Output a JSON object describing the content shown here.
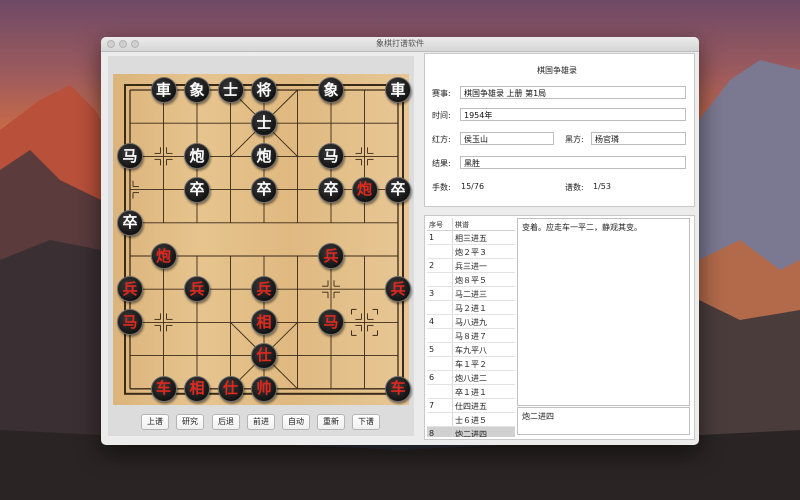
{
  "window": {
    "title": "象棋打谱软件"
  },
  "toolbar": {
    "buttons": [
      {
        "id": "prev-game",
        "label": "上谱"
      },
      {
        "id": "research",
        "label": "研究"
      },
      {
        "id": "back",
        "label": "后退"
      },
      {
        "id": "forward",
        "label": "前进"
      },
      {
        "id": "auto",
        "label": "自动"
      },
      {
        "id": "restart",
        "label": "重新"
      },
      {
        "id": "next-game",
        "label": "下谱"
      }
    ]
  },
  "info": {
    "title": "棋国争雄录",
    "event_label": "赛事:",
    "event_value": "棋国争雄录 上册 第1局",
    "time_label": "时间:",
    "time_value": "1954年",
    "red_label": "红方:",
    "red_value": "侯玉山",
    "black_label": "黑方:",
    "black_value": "杨官璘",
    "result_label": "结果:",
    "result_value": "黑胜",
    "moves_label": "手数:",
    "moves_value": "15/76",
    "games_label": "谱数:",
    "games_value": "1/53"
  },
  "moves": {
    "header_no": "序号",
    "header_move": "棋谱",
    "rows": [
      {
        "no": "1",
        "text": "相三进五"
      },
      {
        "no": "",
        "text": "炮２平３"
      },
      {
        "no": "2",
        "text": "兵三进一"
      },
      {
        "no": "",
        "text": "炮８平５"
      },
      {
        "no": "3",
        "text": "马二进三"
      },
      {
        "no": "",
        "text": "马２进１"
      },
      {
        "no": "4",
        "text": "马八进九"
      },
      {
        "no": "",
        "text": "马８进７"
      },
      {
        "no": "5",
        "text": "车九平八"
      },
      {
        "no": "",
        "text": "车１平２"
      },
      {
        "no": "6",
        "text": "炮八进二"
      },
      {
        "no": "",
        "text": "卒１进１"
      },
      {
        "no": "7",
        "text": "仕四进五"
      },
      {
        "no": "",
        "text": "士６进５"
      },
      {
        "no": "8",
        "text": "炮二进四"
      }
    ],
    "selected_index": 14,
    "comment": "变着。应走车一平二，静观其变。",
    "note": "炮二进四"
  },
  "board": {
    "pieces": [
      {
        "col": 1,
        "row": 0,
        "char": "車",
        "side": "black"
      },
      {
        "col": 2,
        "row": 0,
        "char": "象",
        "side": "black"
      },
      {
        "col": 3,
        "row": 0,
        "char": "士",
        "side": "black"
      },
      {
        "col": 4,
        "row": 0,
        "char": "将",
        "side": "black"
      },
      {
        "col": 6,
        "row": 0,
        "char": "象",
        "side": "black"
      },
      {
        "col": 8,
        "row": 0,
        "char": "車",
        "side": "black"
      },
      {
        "col": 4,
        "row": 1,
        "char": "士",
        "side": "black"
      },
      {
        "col": 0,
        "row": 2,
        "char": "马",
        "side": "black"
      },
      {
        "col": 2,
        "row": 2,
        "char": "炮",
        "side": "black"
      },
      {
        "col": 4,
        "row": 2,
        "char": "炮",
        "side": "black"
      },
      {
        "col": 6,
        "row": 2,
        "char": "马",
        "side": "black"
      },
      {
        "col": 2,
        "row": 3,
        "char": "卒",
        "side": "black"
      },
      {
        "col": 4,
        "row": 3,
        "char": "卒",
        "side": "black"
      },
      {
        "col": 6,
        "row": 3,
        "char": "卒",
        "side": "black"
      },
      {
        "col": 7,
        "row": 3,
        "char": "炮",
        "side": "red"
      },
      {
        "col": 8,
        "row": 3,
        "char": "卒",
        "side": "black"
      },
      {
        "col": 0,
        "row": 4,
        "char": "卒",
        "side": "black"
      },
      {
        "col": 1,
        "row": 5,
        "char": "炮",
        "side": "red"
      },
      {
        "col": 6,
        "row": 5,
        "char": "兵",
        "side": "red"
      },
      {
        "col": 0,
        "row": 6,
        "char": "兵",
        "side": "red"
      },
      {
        "col": 2,
        "row": 6,
        "char": "兵",
        "side": "red"
      },
      {
        "col": 4,
        "row": 6,
        "char": "兵",
        "side": "red"
      },
      {
        "col": 8,
        "row": 6,
        "char": "兵",
        "side": "red"
      },
      {
        "col": 0,
        "row": 7,
        "char": "马",
        "side": "red"
      },
      {
        "col": 4,
        "row": 7,
        "char": "相",
        "side": "red"
      },
      {
        "col": 6,
        "row": 7,
        "char": "马",
        "side": "red"
      },
      {
        "col": 4,
        "row": 8,
        "char": "仕",
        "side": "red"
      },
      {
        "col": 1,
        "row": 9,
        "char": "车",
        "side": "red"
      },
      {
        "col": 2,
        "row": 9,
        "char": "相",
        "side": "red"
      },
      {
        "col": 3,
        "row": 9,
        "char": "仕",
        "side": "red"
      },
      {
        "col": 4,
        "row": 9,
        "char": "帅",
        "side": "red"
      },
      {
        "col": 8,
        "row": 9,
        "char": "车",
        "side": "red"
      }
    ],
    "last_move_from": {
      "col": 7,
      "row": 7
    }
  }
}
